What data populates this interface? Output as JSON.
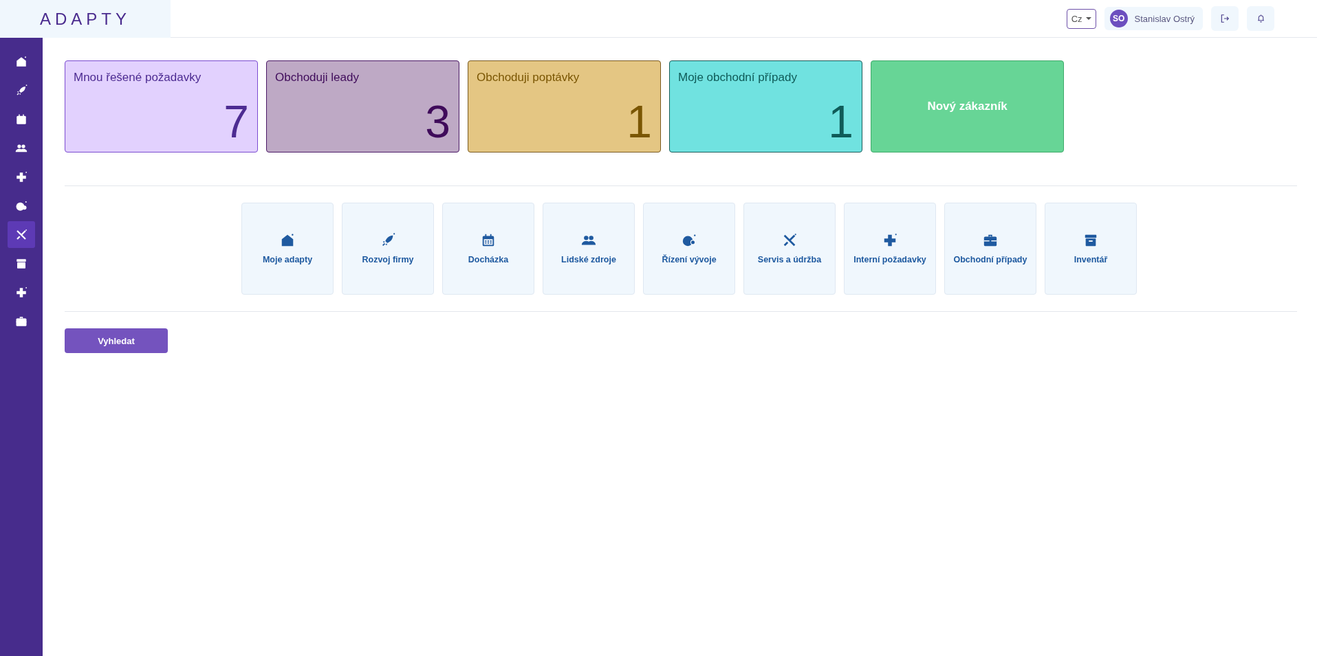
{
  "header": {
    "logo": "ADAPTY",
    "language": "Cz",
    "user": {
      "initials": "SO",
      "name": "Stanislav Ostrý"
    }
  },
  "sidebar": {
    "items": [
      {
        "selected": false
      },
      {
        "selected": false
      },
      {
        "selected": false
      },
      {
        "selected": false
      },
      {
        "selected": false
      },
      {
        "selected": false
      },
      {
        "selected": true
      },
      {
        "selected": false
      },
      {
        "selected": false
      },
      {
        "selected": false
      }
    ]
  },
  "summary_cards": [
    {
      "kind": "stat",
      "title": "Mnou řešené požadavky",
      "count": "7",
      "color": "#e2d1fe"
    },
    {
      "kind": "stat",
      "title": "Obchoduji leady",
      "count": "3",
      "color": "#bea9c5"
    },
    {
      "kind": "stat",
      "title": "Obchoduji poptávky",
      "count": "1",
      "color": "#e4c683"
    },
    {
      "kind": "stat",
      "title": "Moje obchodní případy",
      "count": "1",
      "color": "#70e2e0"
    },
    {
      "kind": "action",
      "title": "Nový zákazník",
      "color": "#67d596"
    }
  ],
  "modules": [
    {
      "label": "Moje adapty"
    },
    {
      "label": "Rozvoj firmy"
    },
    {
      "label": "Docházka"
    },
    {
      "label": "Lidské zdroje"
    },
    {
      "label": "Řízení vývoje"
    },
    {
      "label": "Servis a údržba"
    },
    {
      "label": "Interní požadavky"
    },
    {
      "label": "Obchodní případy"
    },
    {
      "label": "Inventář"
    }
  ],
  "search_button": "Vyhledat"
}
